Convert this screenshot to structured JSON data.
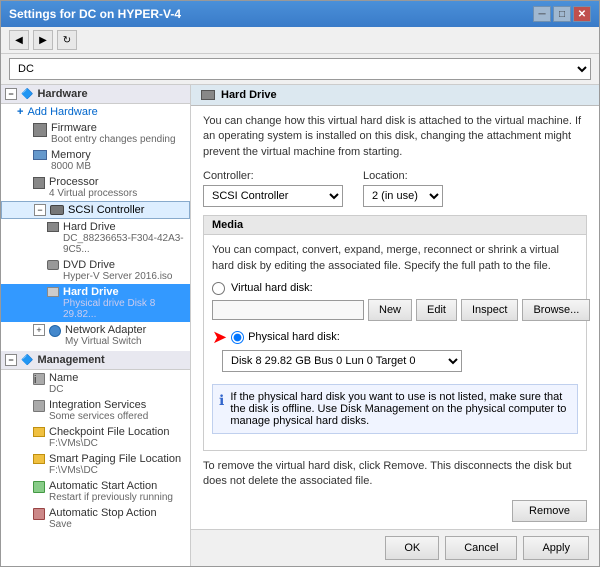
{
  "window": {
    "title": "Settings for DC on HYPER-V-4",
    "minimize_label": "─",
    "maximize_label": "□",
    "close_label": "✕"
  },
  "toolbar": {
    "back_label": "◀",
    "forward_label": "▶",
    "refresh_label": "↻"
  },
  "vm_selector": {
    "value": "DC"
  },
  "sidebar": {
    "hardware_label": "Hardware",
    "add_hardware_label": "Add Hardware",
    "firmware_label": "Firmware",
    "firmware_sub": "Boot entry changes pending",
    "memory_label": "Memory",
    "memory_sub": "8000 MB",
    "processor_label": "Processor",
    "processor_sub": "4 Virtual processors",
    "scsi_label": "SCSI Controller",
    "hard_drive_label": "Hard Drive",
    "hard_drive_sub": "DC_88236653-F304-42A3-9C5...",
    "dvd_drive_label": "DVD Drive",
    "dvd_drive_sub": "Hyper-V Server 2016.iso",
    "hard_drive2_label": "Hard Drive",
    "hard_drive2_sub": "Physical drive Disk 8 29.82...",
    "network_label": "Network Adapter",
    "network_sub": "My Virtual Switch",
    "management_label": "Management",
    "name_label": "Name",
    "name_sub": "DC",
    "integration_label": "Integration Services",
    "integration_sub": "Some services offered",
    "checkpoint_label": "Checkpoint File Location",
    "checkpoint_sub": "F:\\VMs\\DC",
    "smart_paging_label": "Smart Paging File Location",
    "smart_paging_sub": "F:\\VMs\\DC",
    "auto_start_label": "Automatic Start Action",
    "auto_start_sub": "Restart if previously running",
    "auto_stop_label": "Automatic Stop Action",
    "auto_stop_sub": "Save"
  },
  "panel": {
    "header": "Hard Drive",
    "description": "You can change how this virtual hard disk is attached to the virtual machine. If an operating system is installed on this disk, changing the attachment might prevent the virtual machine from starting.",
    "controller_label": "Controller:",
    "controller_value": "SCSI Controller",
    "location_label": "Location:",
    "location_value": "2 (in use)",
    "media_header": "Media",
    "media_description": "You can compact, convert, expand, merge, reconnect or shrink a virtual hard disk by editing the associated file. Specify the full path to the file.",
    "virtual_hd_label": "Virtual hard disk:",
    "virtual_hd_input": "",
    "btn_new": "New",
    "btn_edit": "Edit",
    "btn_inspect": "Inspect",
    "btn_browse": "Browse...",
    "physical_hd_label": "Physical hard disk:",
    "physical_hd_option": "Disk 8 29.82 GB Bus 0 Lun 0 Target 0",
    "info_text": "If the physical hard disk you want to use is not listed, make sure that the disk is offline. Use Disk Management on the physical computer to manage physical hard disks.",
    "remove_text": "To remove the virtual hard disk, click Remove. This disconnects the disk but does not delete the associated file.",
    "btn_remove": "Remove",
    "btn_ok": "OK",
    "btn_cancel": "Cancel",
    "btn_apply": "Apply"
  }
}
